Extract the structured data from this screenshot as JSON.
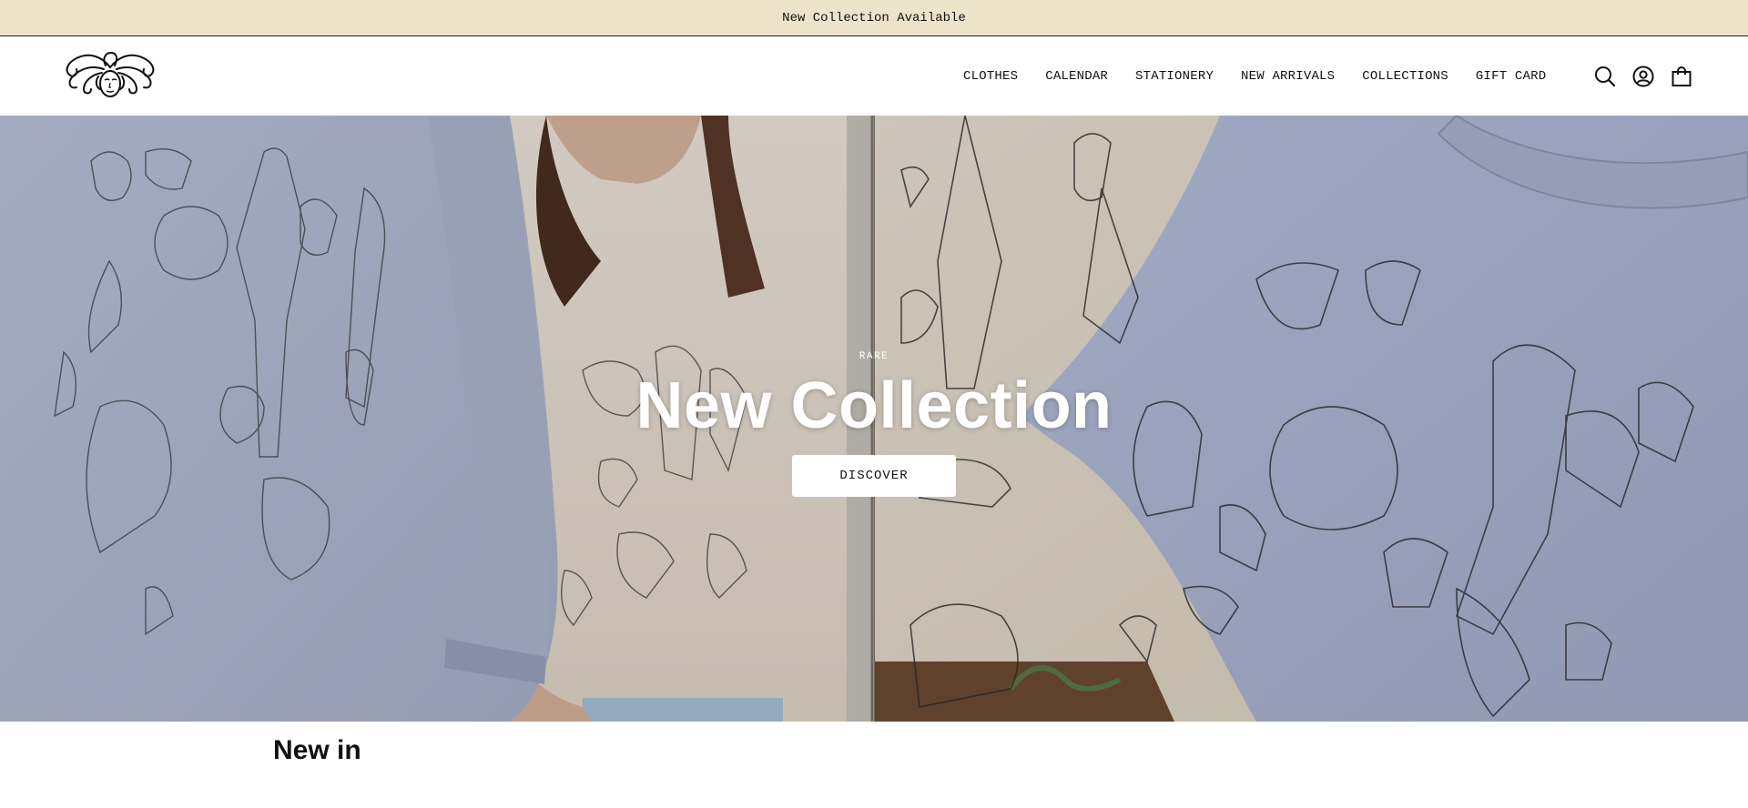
{
  "announcement": {
    "text": "New Collection Available"
  },
  "header": {
    "nav": [
      {
        "label": "CLOTHES"
      },
      {
        "label": "CALENDAR"
      },
      {
        "label": "STATIONERY"
      },
      {
        "label": "NEW ARRIVALS"
      },
      {
        "label": "COLLECTIONS"
      },
      {
        "label": "GIFT CARD"
      }
    ],
    "icons": [
      "search-icon",
      "account-icon",
      "bag-icon"
    ]
  },
  "hero": {
    "eyebrow": "RARE",
    "title": "New Collection",
    "button_label": "DISCOVER"
  },
  "sections": {
    "new_in_title": "New in"
  },
  "colors": {
    "announcement_bg": "#ece3c9",
    "sweatshirt_blue": "#b4bdd6",
    "tee_cream": "#eadfd2",
    "button_bg": "#ffffff"
  }
}
